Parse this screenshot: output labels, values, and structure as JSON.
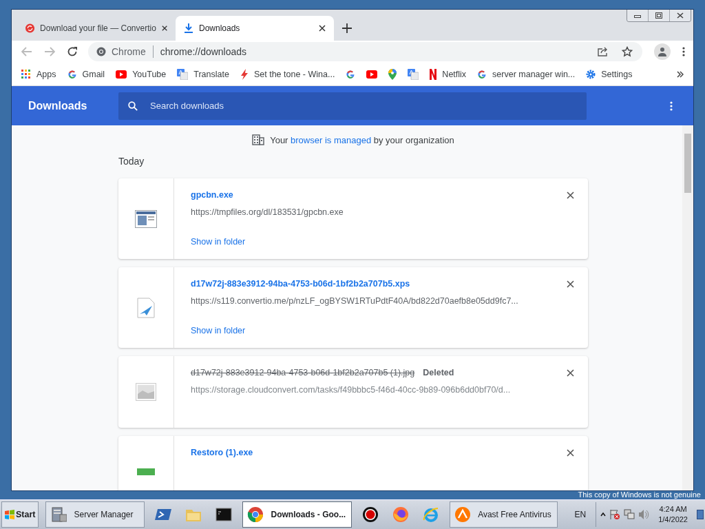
{
  "tabs": [
    {
      "title": "Download your file — Convertio",
      "kind": "convertio",
      "selected": false
    },
    {
      "title": "Downloads",
      "kind": "download",
      "selected": true
    }
  ],
  "address": {
    "origin": "Chrome",
    "url": "chrome://downloads"
  },
  "bookmarks": [
    {
      "label": "Apps",
      "kind": "apps"
    },
    {
      "label": "Gmail",
      "kind": "google"
    },
    {
      "label": "YouTube",
      "kind": "youtube"
    },
    {
      "label": "Translate",
      "kind": "translate"
    },
    {
      "label": "Set the tone - Wina...",
      "kind": "bolt"
    },
    {
      "kind": "google"
    },
    {
      "kind": "youtube"
    },
    {
      "kind": "maps"
    },
    {
      "kind": "translate"
    },
    {
      "label": "Netflix",
      "kind": "netflix"
    },
    {
      "label": "server manager win...",
      "kind": "google"
    },
    {
      "label": "Settings",
      "kind": "gear"
    }
  ],
  "header": {
    "title": "Downloads",
    "search_placeholder": "Search downloads"
  },
  "managed": {
    "before": "Your",
    "link": "browser is managed",
    "after": "by your organization"
  },
  "section": "Today",
  "downloads": [
    {
      "name": "gpcbn.exe",
      "url": "https://tmpfiles.org/dl/183531/gpcbn.exe",
      "action": "Show in folder",
      "deleted": false,
      "kind": "exe"
    },
    {
      "name": "d17w72j-883e3912-94ba-4753-b06d-1bf2b2a707b5.xps",
      "url": "https://s119.convertio.me/p/nzLF_ogBYSW1RTuPdtF40A/bd822d70aefb8e05dd9fc7...",
      "action": "Show in folder",
      "deleted": false,
      "kind": "xps"
    },
    {
      "name": "d17w72j-883e3912-94ba-4753-b06d-1bf2b2a707b5 (1).jpg",
      "status": "Deleted",
      "url": "https://storage.cloudconvert.com/tasks/f49bbbc5-f46d-40cc-9b89-096b6dd0bf70/d...",
      "deleted": true,
      "kind": "image"
    },
    {
      "name": "Restoro (1).exe",
      "deleted": false,
      "kind": "exe2"
    }
  ],
  "taskbar": {
    "start": "Start",
    "items": [
      {
        "label": "Server Manager",
        "kind": "server",
        "selected": false
      },
      {
        "kind": "powershell",
        "selected": false
      },
      {
        "kind": "folder",
        "selected": false
      },
      {
        "kind": "cmd",
        "selected": false
      },
      {
        "label": "Downloads - Goo...",
        "kind": "chrome",
        "selected": true
      },
      {
        "kind": "record",
        "selected": false
      },
      {
        "kind": "firefox",
        "selected": false
      },
      {
        "kind": "ie",
        "selected": false
      },
      {
        "label": "Avast Free Antivirus",
        "kind": "avast",
        "selected": false
      }
    ],
    "language": "EN",
    "time": "4:24 AM",
    "date": "1/4/2022"
  },
  "notice": "This copy of Windows is not genuine"
}
